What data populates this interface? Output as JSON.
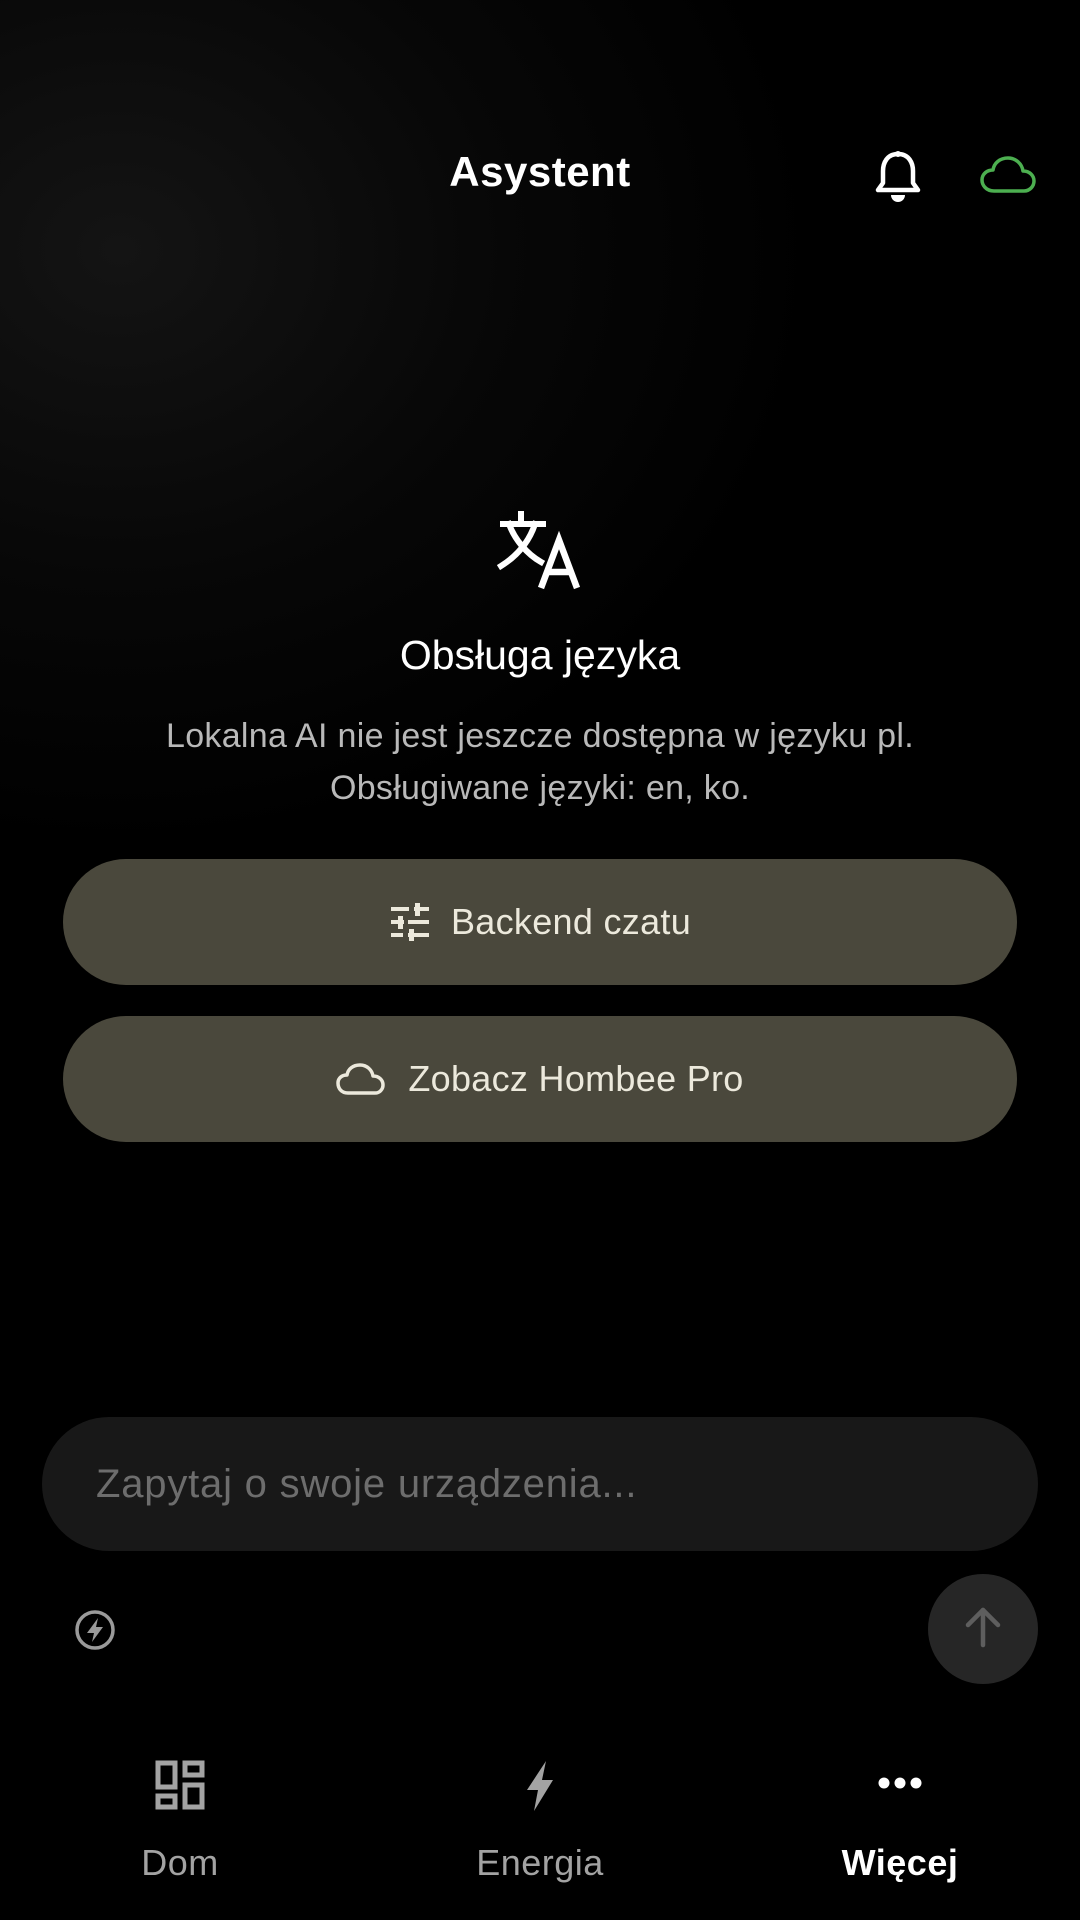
{
  "header": {
    "title": "Asystent",
    "icons": {
      "notifications": "bell-icon",
      "cloud_status": "cloud-icon"
    },
    "cloud_status_color": "#4caf50"
  },
  "notice": {
    "icon": "translate-icon",
    "title": "Obsługa języka",
    "line1": "Lokalna AI nie jest jeszcze dostępna w języku pl.",
    "line2": "Obsługiwane języki: en, ko."
  },
  "actions": {
    "backend": {
      "label": "Backend czatu",
      "icon": "sliders-icon"
    },
    "pro": {
      "label": "Zobacz Hombee Pro",
      "icon": "cloud-icon"
    },
    "button_color": "#4a483c"
  },
  "chat": {
    "placeholder": "Zapytaj o swoje urządzenia...",
    "value": "",
    "quick_toggle_icon": "bolt-circle-icon",
    "send_icon": "arrow-up-icon"
  },
  "nav": {
    "items": [
      {
        "label": "Dom",
        "icon": "dashboard-icon",
        "active": false
      },
      {
        "label": "Energia",
        "icon": "bolt-icon",
        "active": false
      },
      {
        "label": "Więcej",
        "icon": "more-icon",
        "active": true
      }
    ]
  }
}
